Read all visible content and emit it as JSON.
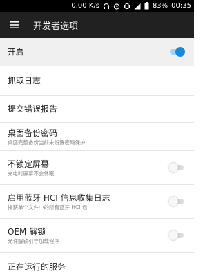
{
  "status_bar": {
    "network_speed": "0.00 K/s",
    "battery": "83%",
    "time": "00:35",
    "icons": [
      "headphones-icon",
      "alarm-icon",
      "vibrate-icon",
      "signal-icon",
      "battery-icon"
    ]
  },
  "app_bar": {
    "title": "开发者选项",
    "menu_icon": "hamburger-menu-icon"
  },
  "master_switch": {
    "label": "开启",
    "enabled": true
  },
  "settings": [
    {
      "title": "抓取日志"
    },
    {
      "title": "提交错误报告"
    },
    {
      "title": "桌面备份密码",
      "summary": "桌面完整备份当前未设置密码保护"
    },
    {
      "title": "不锁定屏幕",
      "summary": "充电时屏幕不会休眠",
      "toggle": false
    },
    {
      "title": "启用蓝牙 HCI 信息收集日志",
      "summary": "捕获单个文件中的所有蓝牙 HCI 包",
      "toggle": false
    },
    {
      "title": "OEM 解锁",
      "summary": "允许解锁引导加载程序",
      "toggle": false
    },
    {
      "title": "正在运行的服务"
    }
  ],
  "colors": {
    "accent": "#1a88d8",
    "app_bar": "#212121",
    "status_bar": "#000000",
    "master_row_bg": "#f0f0f0"
  }
}
